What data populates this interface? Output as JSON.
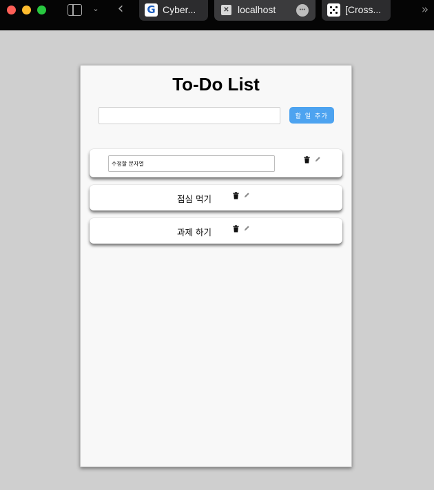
{
  "browser": {
    "tabs": [
      {
        "label": "Cyber...",
        "icon": "cyber-favicon-icon",
        "active": false
      },
      {
        "label": "localhost",
        "icon": "close-tab-icon",
        "active": true
      },
      {
        "label": "[Cross...",
        "icon": "cross-favicon-icon",
        "active": false
      }
    ],
    "colors": {
      "bar": "#050505",
      "tab": "#2c2c2e",
      "active_tab": "#3b3b3d"
    }
  },
  "app": {
    "title": "To-Do List",
    "new_todo": {
      "value": "",
      "placeholder": ""
    },
    "add_button_label": "할 일 추가",
    "accent_color": "#4da3f0",
    "todos": [
      {
        "text": "",
        "editing": true,
        "edit_value": "수정할 문자열"
      },
      {
        "text": "점심 먹기",
        "editing": false
      },
      {
        "text": "과제 하기",
        "editing": false
      }
    ]
  }
}
